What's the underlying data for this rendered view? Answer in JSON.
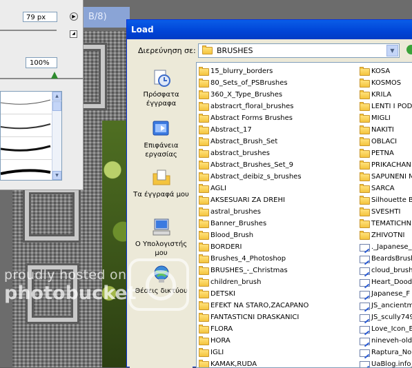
{
  "brush_panel": {
    "size_value": "79 px",
    "opacity_value": "100%",
    "opacity_level": 0.66
  },
  "background_title": "B/8)",
  "dialog": {
    "title": "Load",
    "look_in_label": "Διερεύνηση σε:",
    "look_in_value": "BRUSHES",
    "places": [
      {
        "label": "Πρόσφατα έγγραφα",
        "icon": "recent-documents-icon"
      },
      {
        "label": "Επιφάνεια εργασίας",
        "icon": "desktop-icon"
      },
      {
        "label": "Τα έγγραφά μου",
        "icon": "my-documents-icon"
      },
      {
        "label": "Ο Υπολογιστής μου",
        "icon": "my-computer-icon"
      },
      {
        "label": "Θέσεις δικτύου",
        "icon": "network-places-icon"
      }
    ],
    "files_col1": [
      {
        "name": "15_blurry_borders",
        "type": "folder"
      },
      {
        "name": "80_Sets_of_PSBrushes",
        "type": "folder"
      },
      {
        "name": "360_X_Type_Brushes",
        "type": "folder"
      },
      {
        "name": "abstracrt_floral_brushes",
        "type": "folder"
      },
      {
        "name": "Abstract Forms Brushes",
        "type": "folder"
      },
      {
        "name": "Abstract_17",
        "type": "folder"
      },
      {
        "name": "Abstract_Brush_Set",
        "type": "folder"
      },
      {
        "name": "abstract_brushes",
        "type": "folder"
      },
      {
        "name": "Abstract_Brushes_Set_9",
        "type": "folder"
      },
      {
        "name": "Abstract_deibiz_s_brushes",
        "type": "folder"
      },
      {
        "name": "AGLI",
        "type": "folder"
      },
      {
        "name": "AKSESUARI ZA DREHI",
        "type": "folder"
      },
      {
        "name": "astral_brushes",
        "type": "folder"
      },
      {
        "name": "Banner_Brushes",
        "type": "folder"
      },
      {
        "name": "Blood_Brush",
        "type": "folder"
      },
      {
        "name": "BORDERI",
        "type": "folder"
      },
      {
        "name": "Brushes_4_Photoshop",
        "type": "folder"
      },
      {
        "name": "BRUSHES_-_Christmas",
        "type": "folder"
      },
      {
        "name": "children_brush",
        "type": "folder"
      },
      {
        "name": "DETSKI",
        "type": "folder"
      },
      {
        "name": "EFEKT NA STARO,ZACAPANO",
        "type": "folder"
      },
      {
        "name": "FANTASTICNI DRASKANICI",
        "type": "folder"
      },
      {
        "name": "FLORA",
        "type": "folder"
      },
      {
        "name": "HORA",
        "type": "folder"
      },
      {
        "name": "IGLI",
        "type": "folder"
      },
      {
        "name": "KAMAK,RUDA",
        "type": "folder"
      }
    ],
    "files_col2": [
      {
        "name": "KOSA",
        "type": "folder"
      },
      {
        "name": "KOSMOS",
        "type": "folder"
      },
      {
        "name": "KRILA",
        "type": "folder"
      },
      {
        "name": "LENTI I POD",
        "type": "folder"
      },
      {
        "name": "MIGLI",
        "type": "folder"
      },
      {
        "name": "NAKITI",
        "type": "folder"
      },
      {
        "name": "OBLACI",
        "type": "folder"
      },
      {
        "name": "PETNA",
        "type": "folder"
      },
      {
        "name": "PRIKACHAN",
        "type": "folder"
      },
      {
        "name": "SAPUNENI M",
        "type": "folder"
      },
      {
        "name": "SARCA",
        "type": "folder"
      },
      {
        "name": "Silhouette B",
        "type": "folder"
      },
      {
        "name": "SVESHTI",
        "type": "folder"
      },
      {
        "name": "TEMATICHN",
        "type": "folder"
      },
      {
        "name": "ZHIVOTNI",
        "type": "folder"
      },
      {
        "name": "._Japanese_",
        "type": "abr"
      },
      {
        "name": "BeardsBrush",
        "type": "abr"
      },
      {
        "name": "cloud_brush",
        "type": "abr"
      },
      {
        "name": "Heart_Dood",
        "type": "abr"
      },
      {
        "name": "Japanese_F",
        "type": "abr"
      },
      {
        "name": "JS_ancientm",
        "type": "abr"
      },
      {
        "name": "JS_scully749",
        "type": "abr"
      },
      {
        "name": "Love_Icon_E",
        "type": "abr"
      },
      {
        "name": "nineveh-oldb",
        "type": "abr"
      },
      {
        "name": "Raptura_No",
        "type": "abr"
      },
      {
        "name": "UaBlog.info_",
        "type": "abr"
      }
    ]
  },
  "watermark": {
    "line1": "proudly hosted on",
    "line2": "photobucket"
  }
}
